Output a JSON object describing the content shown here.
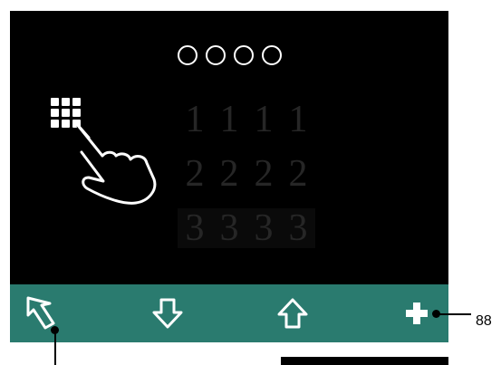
{
  "pin": {
    "circle_count": 4
  },
  "digits": {
    "rows": [
      [
        "1",
        "1",
        "1",
        "1"
      ],
      [
        "2",
        "2",
        "2",
        "2"
      ],
      [
        "3",
        "3",
        "3",
        "3"
      ]
    ]
  },
  "toolbar": {
    "buttons": [
      "back-icon",
      "arrow-down-icon",
      "arrow-up-icon",
      "plus-icon"
    ]
  },
  "callouts": {
    "plus_ref": "88"
  },
  "colors": {
    "screen": "#000000",
    "toolbar": "#2a7b6f",
    "digit": "#262626",
    "icon": "#ffffff"
  }
}
